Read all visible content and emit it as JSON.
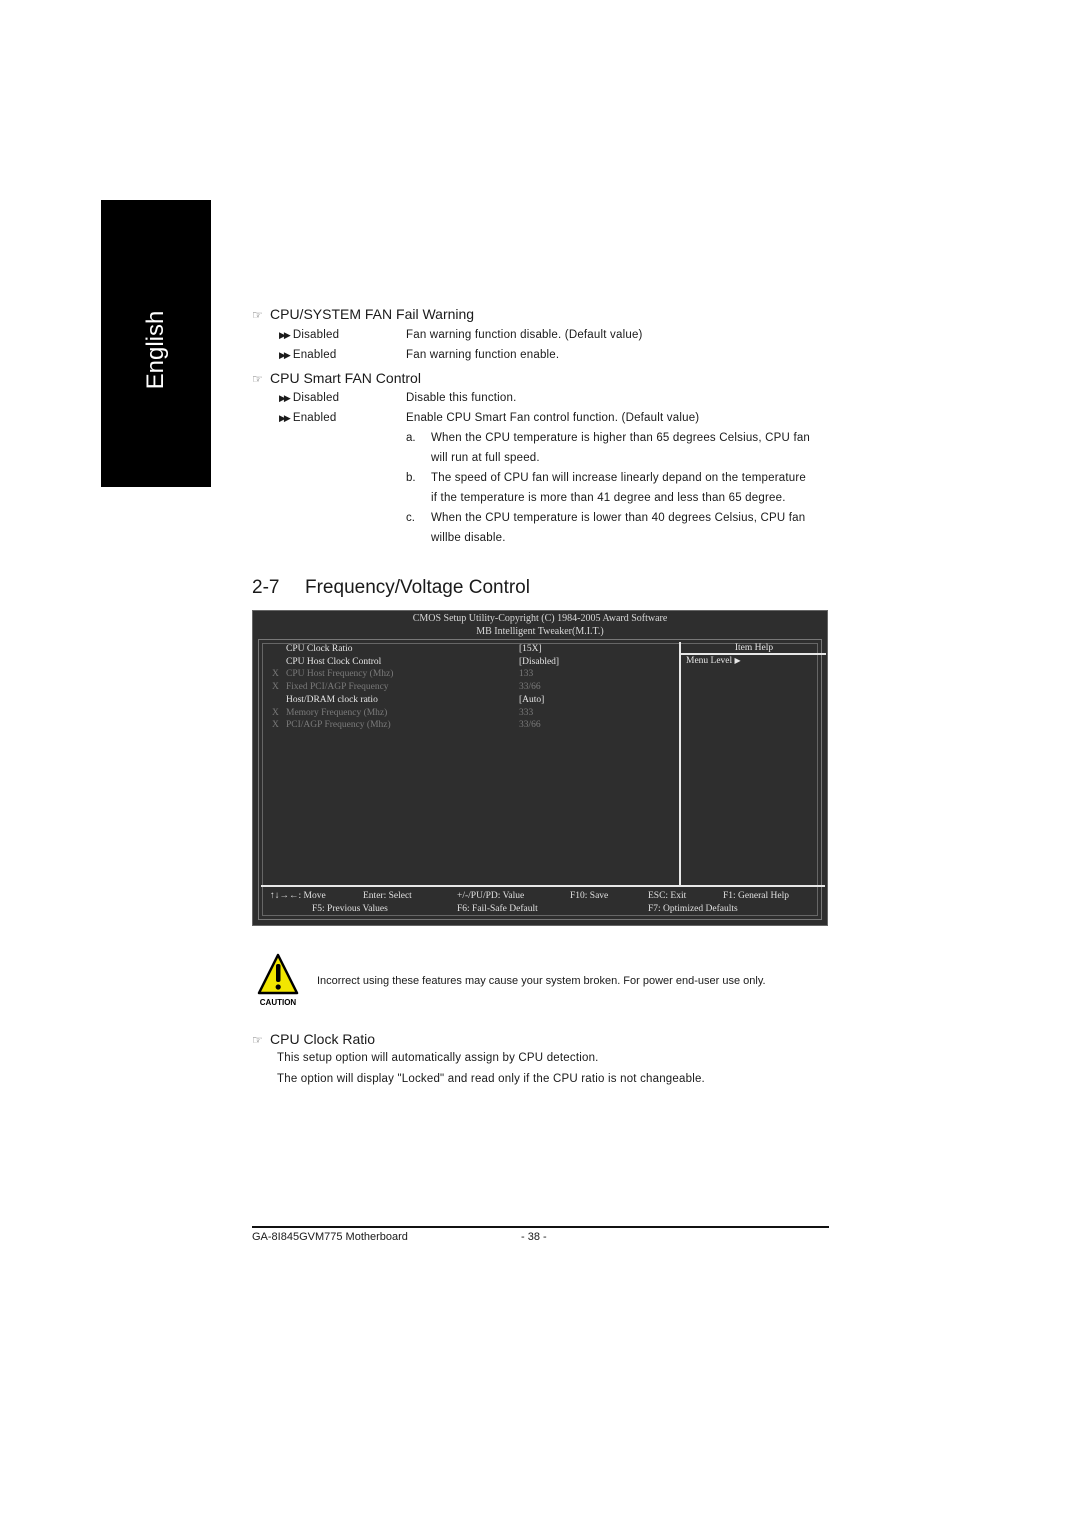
{
  "language_tab": "English",
  "fan_fail_warning": {
    "title": "CPU/SYSTEM FAN Fail Warning",
    "options": [
      {
        "label": "Disabled",
        "desc": "Fan warning function disable. (Default value)"
      },
      {
        "label": "Enabled",
        "desc": "Fan warning function enable."
      }
    ]
  },
  "smart_fan": {
    "title": "CPU Smart FAN Control",
    "options": [
      {
        "label": "Disabled",
        "desc": "Disable this function."
      },
      {
        "label": "Enabled",
        "desc": "Enable CPU Smart Fan control function. (Default value)"
      }
    ],
    "notes": [
      {
        "mark": "a.",
        "line1": "When the CPU temperature is higher than 65 degrees Celsius, CPU fan",
        "line2": "will run at full speed."
      },
      {
        "mark": "b.",
        "line1": "The speed of CPU fan will increase linearly depand on the temperature",
        "line2": "if the temperature is more than 41 degree and less than 65 degree."
      },
      {
        "mark": "c.",
        "line1": "When the CPU temperature is lower than 40 degrees Celsius, CPU fan",
        "line2": "willbe disable."
      }
    ]
  },
  "section": {
    "number": "2-7",
    "title": "Frequency/Voltage Control"
  },
  "bios": {
    "header1": "CMOS Setup Utility-Copyright (C) 1984-2005 Award Software",
    "header2": "MB Intelligent Tweaker(M.I.T.)",
    "items": [
      {
        "prefix": "",
        "label": "CPU Clock Ratio",
        "value": "[15X]",
        "disabled": false
      },
      {
        "prefix": "",
        "label": "CPU Host Clock Control",
        "value": "[Disabled]",
        "disabled": false
      },
      {
        "prefix": "X",
        "label": "CPU Host Frequency (Mhz)",
        "value": "133",
        "disabled": true
      },
      {
        "prefix": "X",
        "label": "Fixed  PCI/AGP Frequency",
        "value": "33/66",
        "disabled": true
      },
      {
        "prefix": "",
        "label": "Host/DRAM clock ratio",
        "value": "[Auto]",
        "disabled": false
      },
      {
        "prefix": "X",
        "label": "Memory Frequency (Mhz)",
        "value": "333",
        "disabled": true
      },
      {
        "prefix": "X",
        "label": "PCI/AGP Frequency (Mhz)",
        "value": "33/66",
        "disabled": true
      }
    ],
    "help_title": "Item Help",
    "menu_level": "Menu Level",
    "keys_row1": [
      "↑↓→←: Move",
      "Enter: Select",
      "+/-/PU/PD: Value",
      "F10: Save",
      "ESC: Exit",
      "F1: General Help"
    ],
    "keys_row2": [
      "F5: Previous Values",
      "F6: Fail-Safe Default",
      "F7: Optimized Defaults"
    ]
  },
  "caution": {
    "label": "CAUTION",
    "text": "Incorrect using these features may cause your system broken. For power end-user use only."
  },
  "clock_ratio": {
    "title": "CPU Clock Ratio",
    "lines": [
      "This setup option will automatically assign by CPU detection.",
      "The option will display \"Locked\" and read only if the CPU ratio is not changeable."
    ]
  },
  "footer": {
    "model": "GA-8I845GVM775 Motherboard",
    "page": "- 38 -"
  }
}
